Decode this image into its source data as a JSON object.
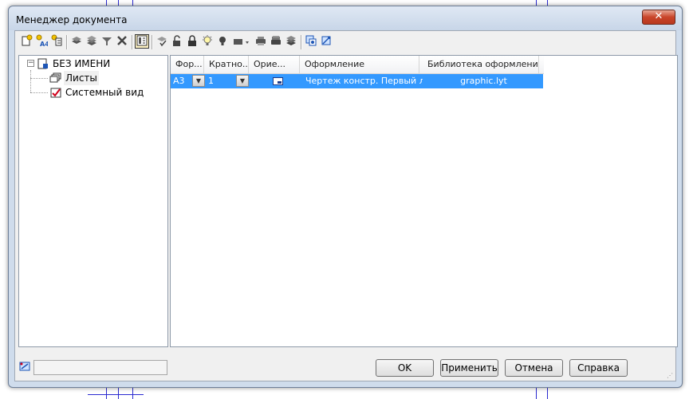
{
  "window": {
    "title": "Менеджер документа",
    "close_symbol": "✕"
  },
  "toolbar": {
    "buttons": [
      {
        "icon": "new-sheet-icon"
      },
      {
        "icon": "new-sheet-a4-icon"
      },
      {
        "icon": "new-view-icon"
      },
      {
        "icon": "layer-icon"
      },
      {
        "icon": "layers-icon"
      },
      {
        "icon": "filter-icon"
      },
      {
        "icon": "delete-icon"
      },
      {
        "icon": "properties-icon",
        "active": true
      },
      {
        "icon": "visibility-icon"
      },
      {
        "icon": "unlock-icon"
      },
      {
        "icon": "lock-icon"
      },
      {
        "icon": "bulb-on-icon"
      },
      {
        "icon": "bulb-off-icon"
      },
      {
        "icon": "color-icon"
      },
      {
        "icon": "print-icon"
      },
      {
        "icon": "print-all-icon"
      },
      {
        "icon": "stack-icon"
      },
      {
        "icon": "view-icon"
      },
      {
        "icon": "view-settings-icon"
      }
    ]
  },
  "tree": {
    "root": {
      "label": "БЕЗ ИМЕНИ",
      "expander": "−"
    },
    "children": [
      {
        "label": "Листы"
      },
      {
        "label": "Системный вид"
      }
    ]
  },
  "grid": {
    "columns": [
      "Фор...",
      "Кратно...",
      "Орие...",
      "Оформление",
      "Библиотека оформлений"
    ],
    "rows": [
      {
        "format": "A3",
        "multiplicity": "1",
        "orientation": "landscape",
        "design": "Чертеж констр. Первый ли",
        "library": "graphic.lyt"
      }
    ]
  },
  "buttons": {
    "ok": "OK",
    "apply": "Применить",
    "cancel": "Отмена",
    "help": "Справка"
  }
}
